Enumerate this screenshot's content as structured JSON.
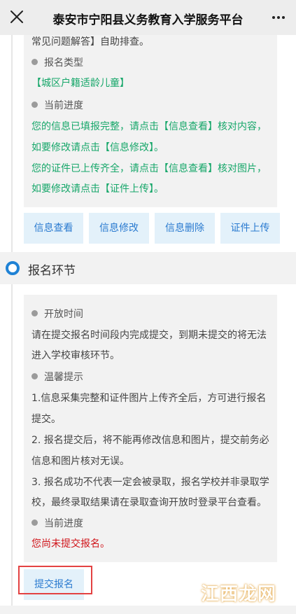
{
  "topbar": {
    "title": "泰安市宁阳县义务教育入学服务平台"
  },
  "card1": {
    "faq_tail": "常见问题解答】自助排查。",
    "type_label": "报名类型",
    "type_value": "【城区户籍适龄儿童】",
    "progress_label": "当前进度",
    "progress_lines": [
      "您的信息已填报完整，请点击【信息查看】核对内容，",
      "如要修改请点击【信息修改】。",
      "您的证件已上传齐全，请点击【信息查看】核对图片，",
      "如要修改请点击【证件上传】。"
    ]
  },
  "actions": {
    "view": "信息查看",
    "edit": "信息修改",
    "delete": "信息删除",
    "upload": "证件上传"
  },
  "section": {
    "title": "报名环节"
  },
  "card2": {
    "open_label": "开放时间",
    "open_lines": [
      "请在提交报名时间段内完成提交，到期未提交的将无法",
      "进入学校审核环节。"
    ],
    "tips_label": "温馨提示",
    "tips_lines": [
      "1.信息采集完整和证件图片上传齐全后，方可进行报名",
      "提交。",
      "2. 报名提交后，将不能再修改信息和图片，提交前务必",
      "信息和图片核对无误。",
      "3. 报名成功不代表一定会被录取，报名学校并非录取学",
      "校，最终录取结果请在录取查询开放时登录平台查看。"
    ],
    "progress_label": "当前进度",
    "progress_value": "您尚未提交报名。"
  },
  "submit": {
    "label": "提交报名"
  },
  "watermark": {
    "text": "江西龙网"
  },
  "colors": {
    "accent": "#1f82d5",
    "green_text": "#17a76a",
    "red_text": "#d0141a",
    "button_bg": "#e3f1fa",
    "highlight_border": "#e34242"
  },
  "icons": {
    "close": "close-icon",
    "more": "more-icon",
    "bullet": "dot-icon",
    "step": "step-ring-icon"
  }
}
